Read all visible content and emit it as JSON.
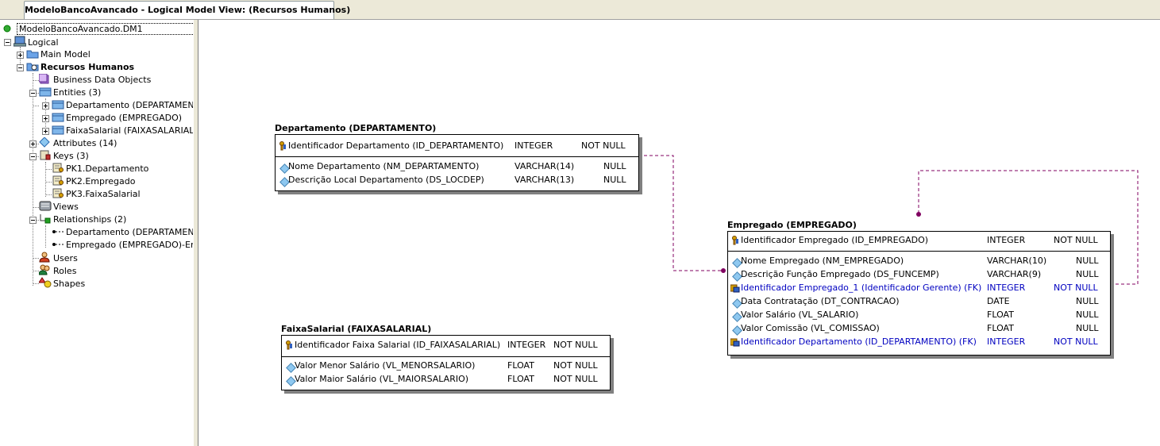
{
  "window": {
    "tab_title": "ModeloBancoAvancado - Logical Model View: (Recursos Humanos)"
  },
  "tree": {
    "root": "ModeloBancoAvancado.DM1",
    "logical": "Logical",
    "main_model": "Main Model",
    "submodel": "Recursos Humanos",
    "business_data_objects": "Business Data Objects",
    "entities": "Entities (3)",
    "entity_items": [
      "Departamento (DEPARTAMENTO)",
      "Empregado (EMPREGADO)",
      "FaixaSalarial (FAIXASALARIAL)"
    ],
    "attributes": "Attributes (14)",
    "keys": "Keys (3)",
    "key_items": [
      "PK1.Departamento",
      "PK2.Empregado",
      "PK3.FaixaSalarial"
    ],
    "views": "Views",
    "relationships": "Relationships (2)",
    "relationship_items": [
      "Departamento (DEPARTAMENTO)-Empregado (EMPREGADO)",
      "Empregado (EMPREGADO)-Empregado (EMPREGADO)"
    ],
    "users": "Users",
    "roles": "Roles",
    "shapes": "Shapes"
  },
  "diagram": {
    "colors": {
      "fk_text": "#0000c0",
      "relationship_line": "#800060",
      "shadow": "#808080"
    },
    "departamento": {
      "title": "Departamento (DEPARTAMENTO)",
      "pk_rows": [
        {
          "name": "Identificador Departamento (ID_DEPARTAMENTO)",
          "type": "INTEGER",
          "null": "NOT NULL",
          "icon": "key-icon"
        }
      ],
      "rows": [
        {
          "name": "Nome Departamento (NM_DEPARTAMENTO)",
          "type": "VARCHAR(14)",
          "null": "NULL",
          "icon": "attribute-icon"
        },
        {
          "name": "Descrição Local Departamento (DS_LOCDEP)",
          "type": "VARCHAR(13)",
          "null": "NULL",
          "icon": "attribute-icon"
        }
      ]
    },
    "empregado": {
      "title": "Empregado (EMPREGADO)",
      "pk_rows": [
        {
          "name": "Identificador Empregado (ID_EMPREGADO)",
          "type": "INTEGER",
          "null": "NOT NULL",
          "icon": "key-icon"
        }
      ],
      "rows": [
        {
          "name": "Nome Empregado (NM_EMPREGADO)",
          "type": "VARCHAR(10)",
          "null": "NULL",
          "icon": "attribute-icon"
        },
        {
          "name": "Descrição Função Empregado (DS_FUNCEMP)",
          "type": "VARCHAR(9)",
          "null": "NULL",
          "icon": "attribute-icon"
        },
        {
          "name": "Identificador Empregado_1 (Identificador Gerente) (FK)",
          "type": "INTEGER",
          "null": "NOT NULL",
          "icon": "foreign-key-icon",
          "fk": true
        },
        {
          "name": "Data Contratação (DT_CONTRACAO)",
          "type": "DATE",
          "null": "NULL",
          "icon": "attribute-icon"
        },
        {
          "name": "Valor Salário (VL_SALARIO)",
          "type": "FLOAT",
          "null": "NULL",
          "icon": "attribute-icon"
        },
        {
          "name": "Valor Comissão (VL_COMISSAO)",
          "type": "FLOAT",
          "null": "NULL",
          "icon": "attribute-icon"
        },
        {
          "name": "Identificador Departamento (ID_DEPARTAMENTO) (FK)",
          "type": "INTEGER",
          "null": "NOT NULL",
          "icon": "foreign-key-icon",
          "fk": true
        }
      ]
    },
    "faixasalarial": {
      "title": "FaixaSalarial (FAIXASALARIAL)",
      "pk_rows": [
        {
          "name": "Identificador Faixa Salarial (ID_FAIXASALARIAL)",
          "type": "INTEGER",
          "null": "NOT NULL",
          "icon": "key-icon"
        }
      ],
      "rows": [
        {
          "name": "Valor Menor Salário (VL_MENORSALARIO)",
          "type": "FLOAT",
          "null": "NOT NULL",
          "icon": "attribute-icon"
        },
        {
          "name": "Valor Maior Salário (VL_MAIORSALARIO)",
          "type": "FLOAT",
          "null": "NOT NULL",
          "icon": "attribute-icon"
        }
      ]
    }
  }
}
